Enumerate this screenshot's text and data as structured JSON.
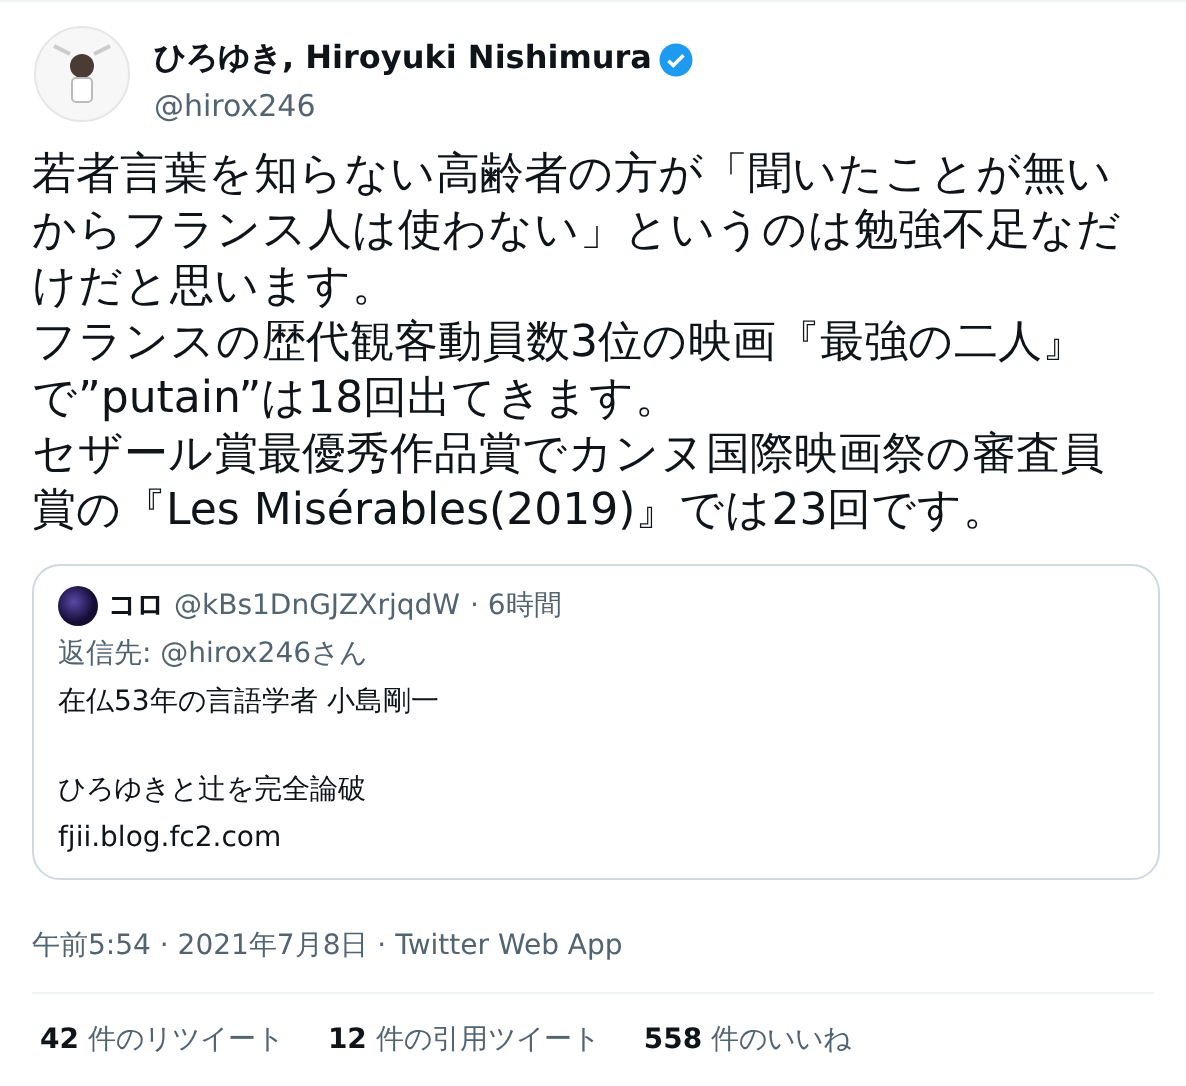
{
  "author": {
    "name": "ひろゆき, Hiroyuki Nishimura",
    "verified": true,
    "handle": "@hirox246"
  },
  "body": [
    "若者言葉を知らない高齢者の方が「聞いたことが無いからフランス人は使わない」というのは勉強不足なだけだと思います。",
    "フランスの歴代観客動員数3位の映画『最強の二人』で”putain”は18回出てきます。",
    "セザール賞最優秀作品賞でカンヌ国際映画祭の審査員賞の『Les Misérables(2019)』では23回です。"
  ],
  "quote": {
    "name": "コロ",
    "handle": "@kBs1DnGJZXrjqdW",
    "time": "· 6時間",
    "reply_to": "返信先: @hirox246さん",
    "lines": [
      "在仏53年の言語学者 小島剛一",
      "ひろゆきと辻を完全論破"
    ],
    "link": "fjii.blog.fc2.com"
  },
  "timestamp": "午前5:54 · 2021年7月8日 · Twitter Web App",
  "stats": [
    {
      "count": "42",
      "label": "件のリツイート"
    },
    {
      "count": "12",
      "label": "件の引用ツイート"
    },
    {
      "count": "558",
      "label": "件のいいね"
    }
  ]
}
